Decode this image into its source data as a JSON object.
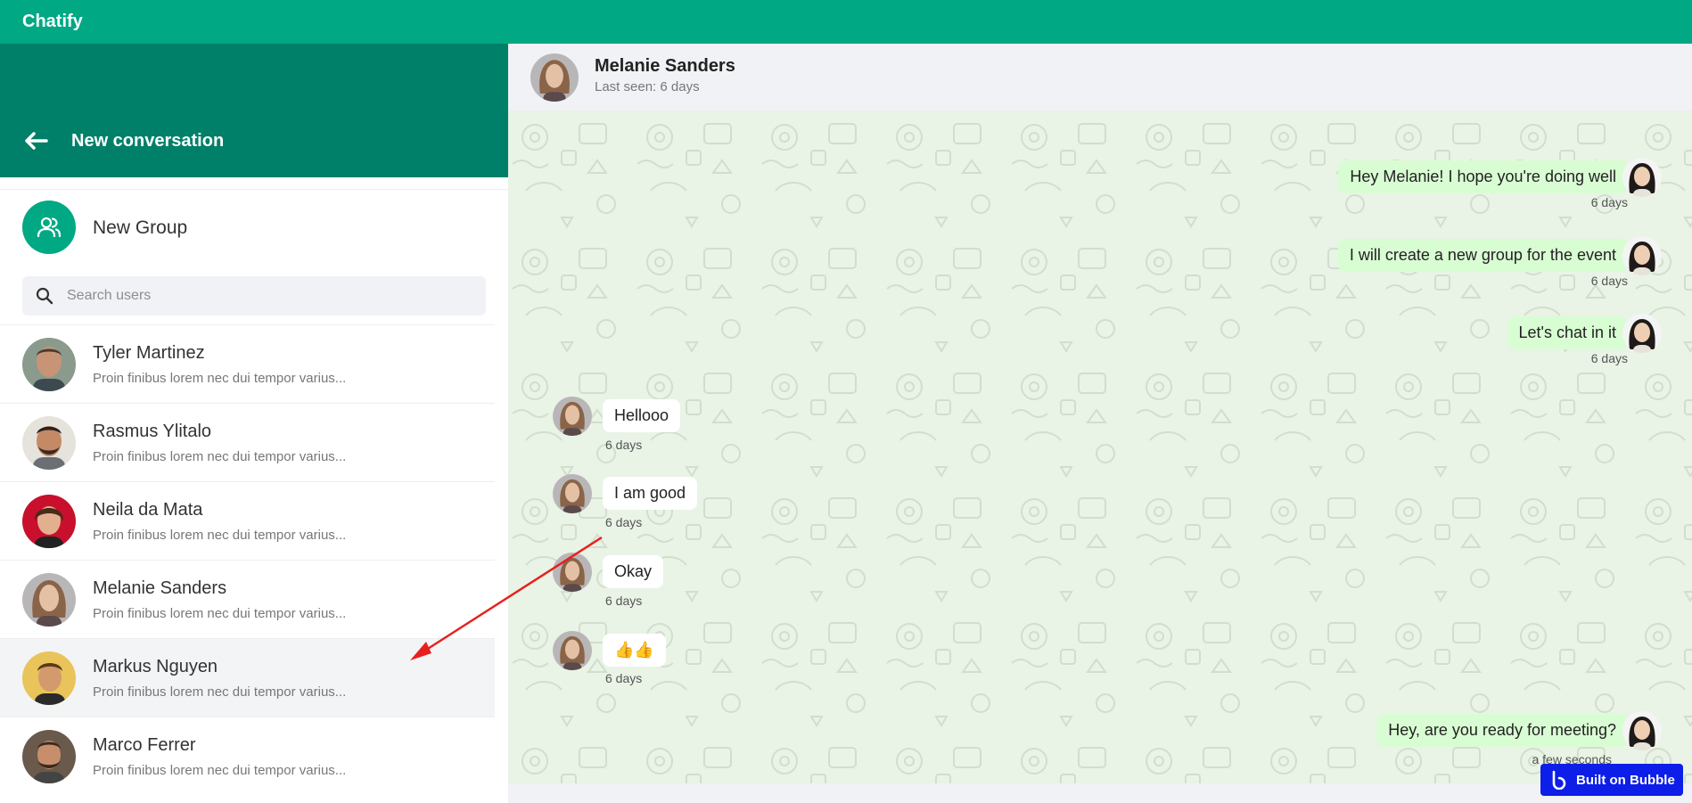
{
  "app": {
    "title": "Chatify"
  },
  "sidebar": {
    "header_title": "New conversation",
    "new_group_label": "New Group",
    "search_placeholder": "Search users",
    "contacts": [
      {
        "name": "Tyler Martinez",
        "preview": "Proin finibus lorem nec dui tempor varius..."
      },
      {
        "name": "Rasmus Ylitalo",
        "preview": "Proin finibus lorem nec dui tempor varius..."
      },
      {
        "name": "Neila da Mata",
        "preview": "Proin finibus lorem nec dui tempor varius..."
      },
      {
        "name": "Melanie Sanders",
        "preview": "Proin finibus lorem nec dui tempor varius..."
      },
      {
        "name": "Markus Nguyen",
        "preview": "Proin finibus lorem nec dui tempor varius..."
      },
      {
        "name": "Marco Ferrer",
        "preview": "Proin finibus lorem nec dui tempor varius..."
      }
    ]
  },
  "chat": {
    "contact_name": "Melanie Sanders",
    "last_seen": "Last seen: 6 days",
    "messages": [
      {
        "direction": "out",
        "text": "Hey Melanie! I hope you're doing well",
        "time": "6 days"
      },
      {
        "direction": "out",
        "text": "I will create a new group for the event",
        "time": "6 days"
      },
      {
        "direction": "out",
        "text": "Let's chat in it",
        "time": "6 days"
      },
      {
        "direction": "in",
        "text": "Hellooo",
        "time": "6 days"
      },
      {
        "direction": "in",
        "text": "I am good",
        "time": "6 days"
      },
      {
        "direction": "in",
        "text": "Okay",
        "time": "6 days"
      },
      {
        "direction": "in",
        "text": "👍👍",
        "time": "6 days"
      },
      {
        "direction": "out",
        "text": "Hey, are you ready for meeting?",
        "time": "a few seconds"
      }
    ]
  },
  "badge": {
    "label": "Built on Bubble"
  },
  "colors": {
    "brand": "#00a884",
    "header_dark": "#008069",
    "outgoing_bubble": "#d9fdd3",
    "badge": "#0d1ee8",
    "annotation": "#e8201d"
  }
}
